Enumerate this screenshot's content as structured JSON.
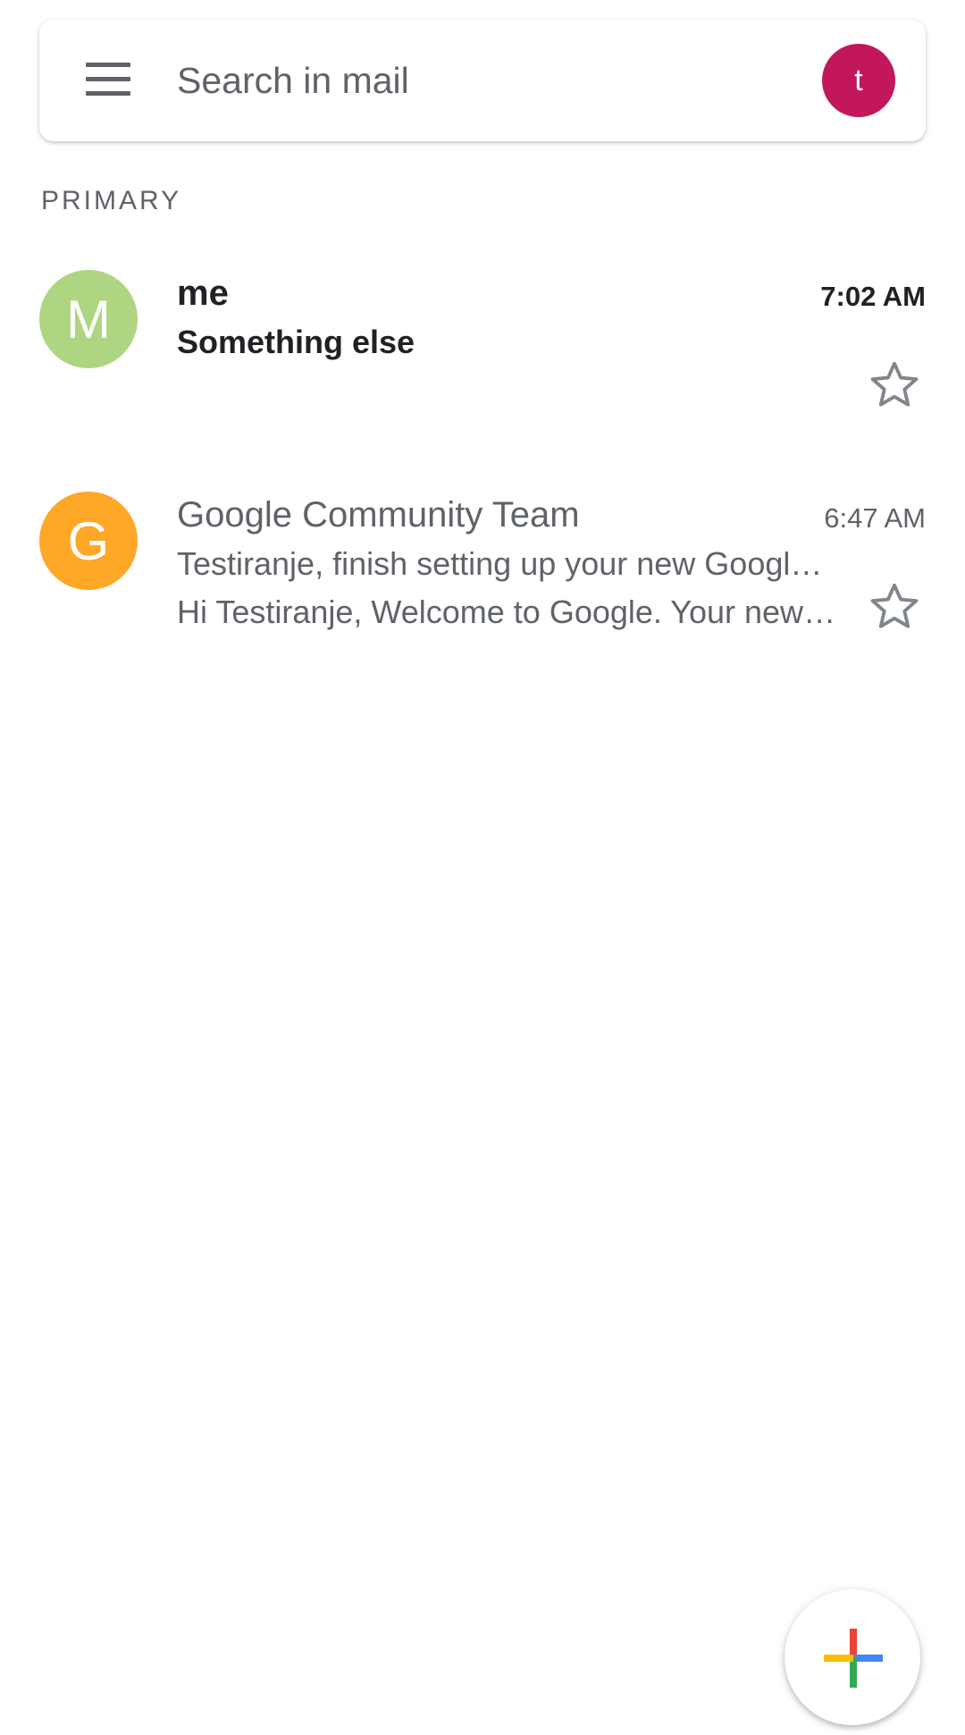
{
  "search": {
    "placeholder": "Search in mail",
    "account_initial": "t",
    "account_color": "#c2185b"
  },
  "inbox": {
    "section_label": "PRIMARY",
    "emails": [
      {
        "avatar_letter": "M",
        "avatar_color": "#aed581",
        "sender": "me",
        "subject": "Something else",
        "snippet": "",
        "time": "7:02 AM",
        "unread": true,
        "starred": false
      },
      {
        "avatar_letter": "G",
        "avatar_color": "#ffa726",
        "sender": "Google Community Team",
        "subject": "Testiranje, finish setting up your new Google Account",
        "snippet": "Hi Testiranje, Welcome to Google. Your new account",
        "time": "6:47 AM",
        "unread": false,
        "starred": false
      }
    ]
  },
  "icons": {
    "menu": "menu-icon",
    "star": "star-outline-icon",
    "compose": "compose-plus-icon"
  },
  "colors": {
    "compose_plus": [
      "#ea4335",
      "#4285f4",
      "#34a853",
      "#fbbc04"
    ]
  }
}
